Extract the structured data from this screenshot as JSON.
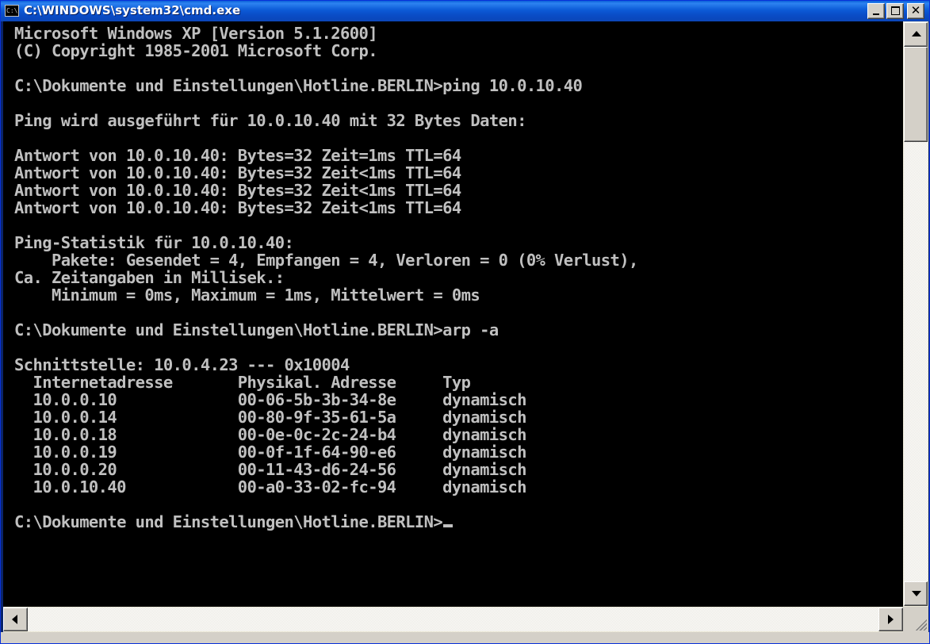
{
  "window": {
    "title": "C:\\WINDOWS\\system32\\cmd.exe",
    "icon_text": "C:\\",
    "buttons": {
      "close_symbol": "✕"
    }
  },
  "console": {
    "lines": [
      "Microsoft Windows XP [Version 5.1.2600]",
      "(C) Copyright 1985-2001 Microsoft Corp.",
      "",
      "C:\\Dokumente und Einstellungen\\Hotline.BERLIN>ping 10.0.10.40",
      "",
      "Ping wird ausgeführt für 10.0.10.40 mit 32 Bytes Daten:",
      "",
      "Antwort von 10.0.10.40: Bytes=32 Zeit=1ms TTL=64",
      "Antwort von 10.0.10.40: Bytes=32 Zeit<1ms TTL=64",
      "Antwort von 10.0.10.40: Bytes=32 Zeit<1ms TTL=64",
      "Antwort von 10.0.10.40: Bytes=32 Zeit<1ms TTL=64",
      "",
      "Ping-Statistik für 10.0.10.40:",
      "    Pakete: Gesendet = 4, Empfangen = 4, Verloren = 0 (0% Verlust),",
      "Ca. Zeitangaben in Millisek.:",
      "    Minimum = 0ms, Maximum = 1ms, Mittelwert = 0ms",
      "",
      "C:\\Dokumente und Einstellungen\\Hotline.BERLIN>arp -a",
      "",
      "Schnittstelle: 10.0.4.23 --- 0x10004",
      "  Internetadresse       Physikal. Adresse     Typ",
      "  10.0.0.10             00-06-5b-3b-34-8e     dynamisch",
      "  10.0.0.14             00-80-9f-35-61-5a     dynamisch",
      "  10.0.0.18             00-0e-0c-2c-24-b4     dynamisch",
      "  10.0.0.19             00-0f-1f-64-90-e6     dynamisch",
      "  10.0.0.20             00-11-43-d6-24-56     dynamisch",
      "  10.0.10.40            00-a0-33-02-fc-94     dynamisch",
      "",
      "C:\\Dokumente und Einstellungen\\Hotline.BERLIN>"
    ]
  },
  "colors": {
    "console_bg": "#000000",
    "console_fg": "#c0c0c0",
    "titlebar": "#0a4cc6"
  }
}
